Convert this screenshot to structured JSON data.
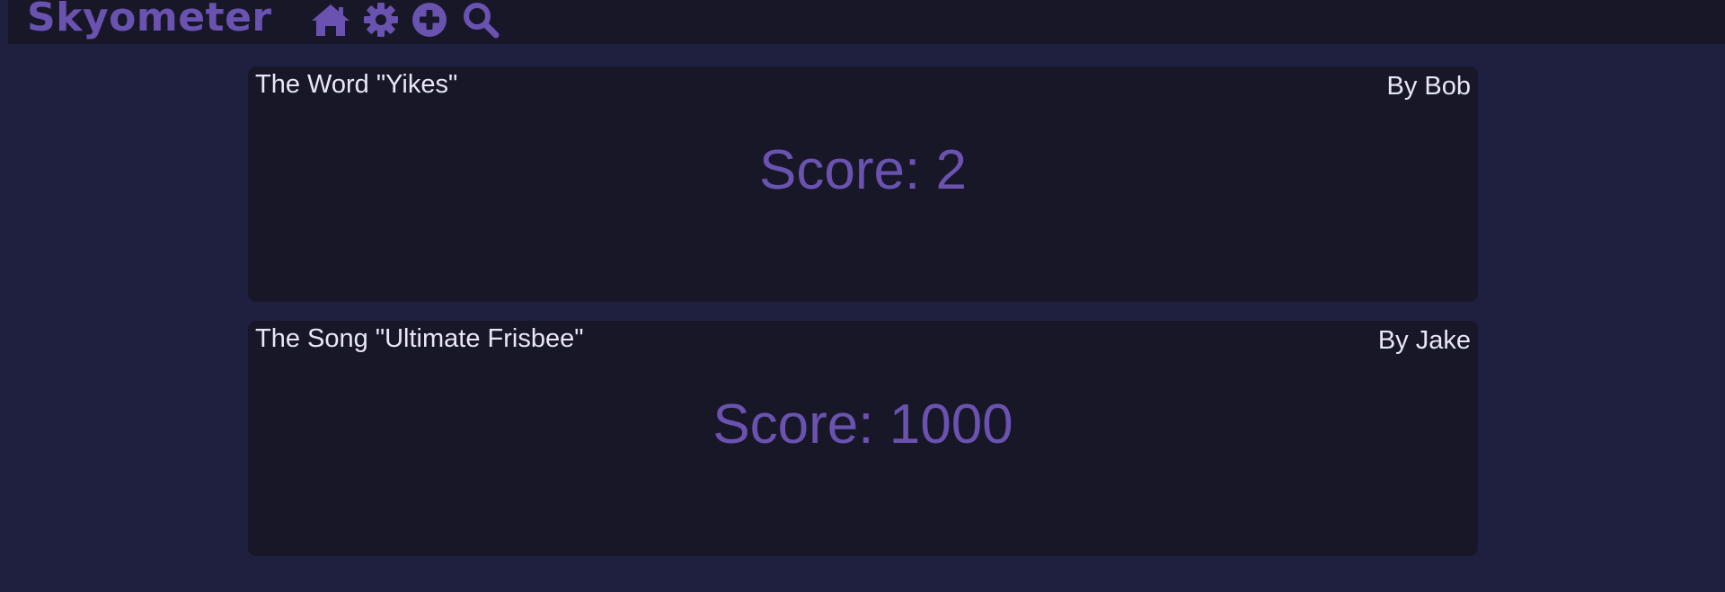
{
  "app": {
    "brand": "Skyometer"
  },
  "nav": {
    "icons": [
      {
        "name": "home-icon"
      },
      {
        "name": "gear-icon"
      },
      {
        "name": "plus-circle-icon"
      },
      {
        "name": "search-icon"
      }
    ]
  },
  "colors": {
    "background": "#1f2040",
    "panel": "#181727",
    "accent": "#6a53b0",
    "text": "#e9e6f5"
  },
  "posts": [
    {
      "title": "The Word \"Yikes\"",
      "author": "By Bob",
      "score": "Score: 2"
    },
    {
      "title": "The Song \"Ultimate Frisbee\"",
      "author": "By Jake",
      "score": "Score: 1000"
    }
  ]
}
